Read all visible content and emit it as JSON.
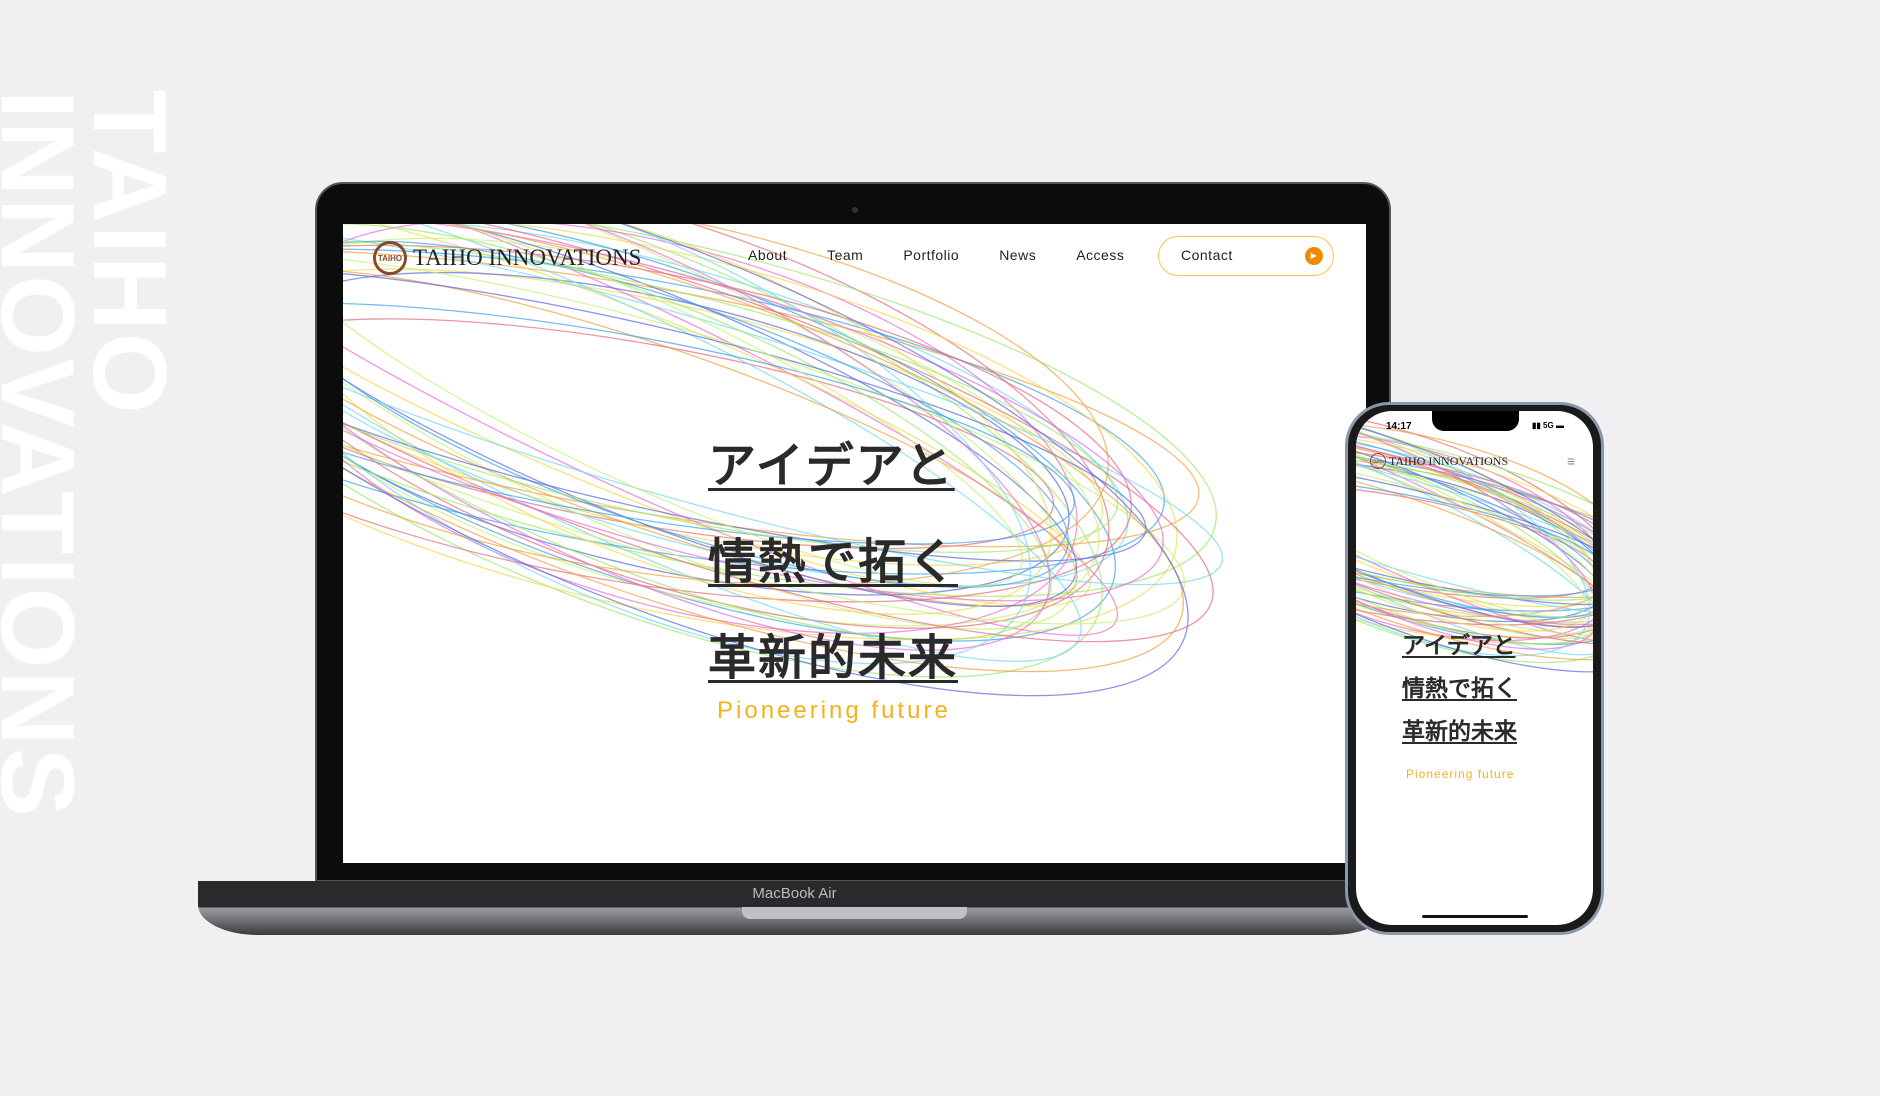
{
  "background_text": [
    "TAIHO",
    "INNOVATIONS"
  ],
  "laptop": {
    "model_label": "MacBook Air",
    "site": {
      "logo_badge": "TAIHO",
      "logo_text": "TAIHO INNOVATIONS",
      "nav": [
        "About",
        "Team",
        "Portfolio",
        "News",
        "Access"
      ],
      "contact_label": "Contact",
      "headline": [
        "アイデアと",
        "情熱で拓く",
        "革新的未来"
      ],
      "subtitle": "Pioneering future"
    }
  },
  "phone": {
    "time": "14:17",
    "status": "5G",
    "site": {
      "logo_badge": "TAIHO",
      "logo_text": "TAIHO INNOVATIONS",
      "headline": [
        "アイデアと",
        "情熱で拓く",
        "革新的未来"
      ],
      "subtitle": "Pioneering future"
    }
  },
  "colors": {
    "accent": "#f2b21c",
    "contact_dot": "#f08a00",
    "logo": "#8b4a26",
    "background": "#f0f0f2"
  }
}
